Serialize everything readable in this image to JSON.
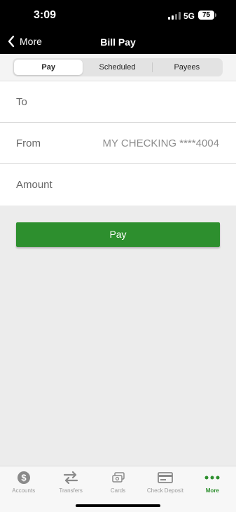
{
  "status_bar": {
    "time": "3:09",
    "network": "5G",
    "battery": "75"
  },
  "nav": {
    "back_label": "More",
    "title": "Bill Pay"
  },
  "segments": [
    {
      "label": "Pay",
      "active": true
    },
    {
      "label": "Scheduled",
      "active": false
    },
    {
      "label": "Payees",
      "active": false
    }
  ],
  "form": {
    "to_label": "To",
    "to_value": "",
    "from_label": "From",
    "from_value": "MY CHECKING ****4004",
    "amount_label": "Amount",
    "amount_value": ""
  },
  "pay_button": "Pay",
  "tabs": [
    {
      "label": "Accounts",
      "icon": "dollar-circle-icon",
      "active": false
    },
    {
      "label": "Transfers",
      "icon": "transfer-arrows-icon",
      "active": false
    },
    {
      "label": "Cards",
      "icon": "cards-icon",
      "active": false
    },
    {
      "label": "Check Deposit",
      "icon": "check-deposit-icon",
      "active": false
    },
    {
      "label": "More",
      "icon": "more-dots-icon",
      "active": true
    }
  ],
  "colors": {
    "accent": "#2d8f2e",
    "nav_bg": "#000000",
    "page_bg": "#ececec"
  }
}
